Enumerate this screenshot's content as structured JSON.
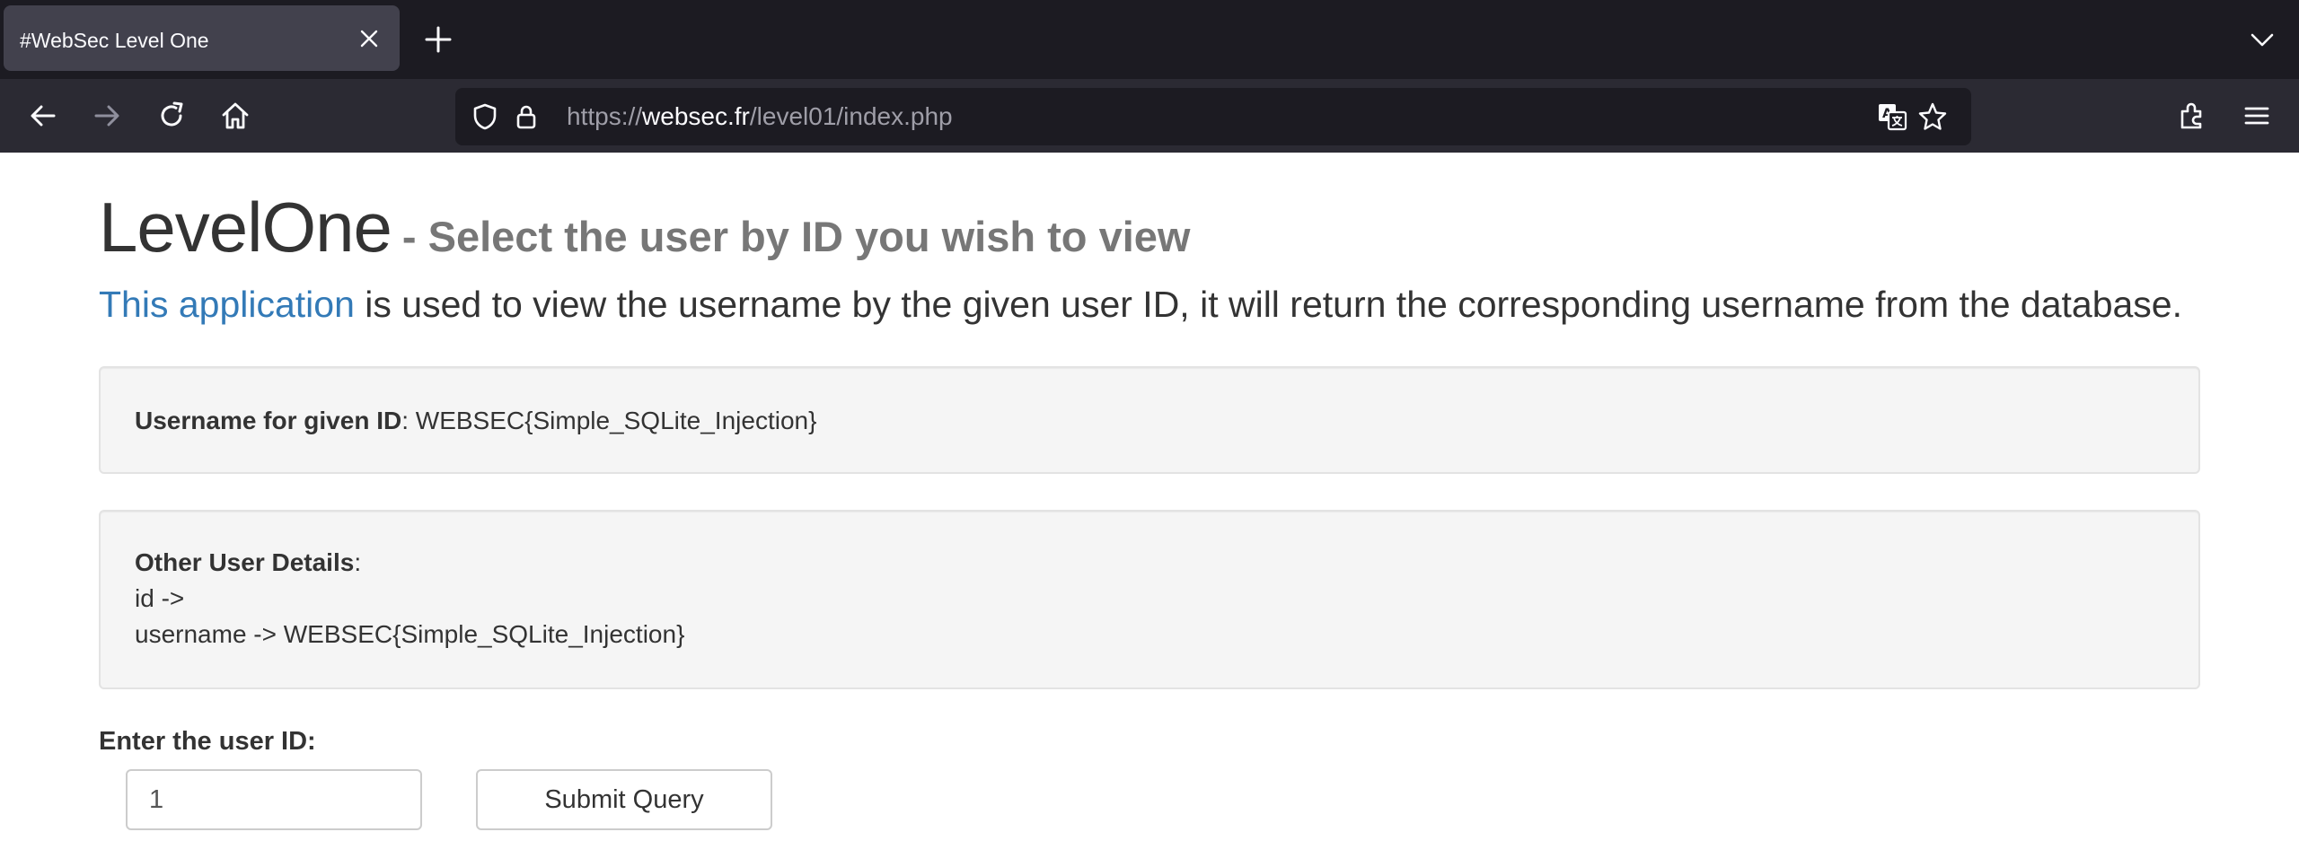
{
  "browser": {
    "tab": {
      "title": "#WebSec Level One"
    },
    "url": {
      "scheme": "https://",
      "host": "websec.fr",
      "path": "/level01/index.php"
    },
    "icons": {
      "back": "back-arrow-icon",
      "forward": "forward-arrow-icon",
      "reload": "reload-icon",
      "home": "home-icon",
      "shield": "shield-icon",
      "lock": "lock-icon",
      "translate": "translate-icon",
      "bookmark": "star-icon",
      "extensions": "extensions-icon",
      "menu": "hamburger-menu-icon"
    },
    "colors": {
      "tabstrip": "#1c1b22",
      "toolbar": "#2b2a33",
      "active_tab": "#42414d"
    }
  },
  "page": {
    "title": "LevelOne",
    "subtitle": "- Select the user by ID you wish to view",
    "intro": {
      "link_text": "This application",
      "text": " is used to view the username by the given user ID, it will return the corresponding username from the database."
    },
    "result": {
      "label": "Username for given ID",
      "separator": ": ",
      "value": "WEBSEC{Simple_SQLite_Injection}"
    },
    "details": {
      "label": "Other User Details",
      "separator": ":",
      "line1": "id ->",
      "line2": "username -> WEBSEC{Simple_SQLite_Injection}"
    },
    "form": {
      "label": "Enter the user ID:",
      "input_value": "1",
      "submit_label": "Submit Query"
    },
    "colors": {
      "link": "#337ab7",
      "well_bg": "#f5f5f5",
      "subtitle": "#777777"
    }
  }
}
